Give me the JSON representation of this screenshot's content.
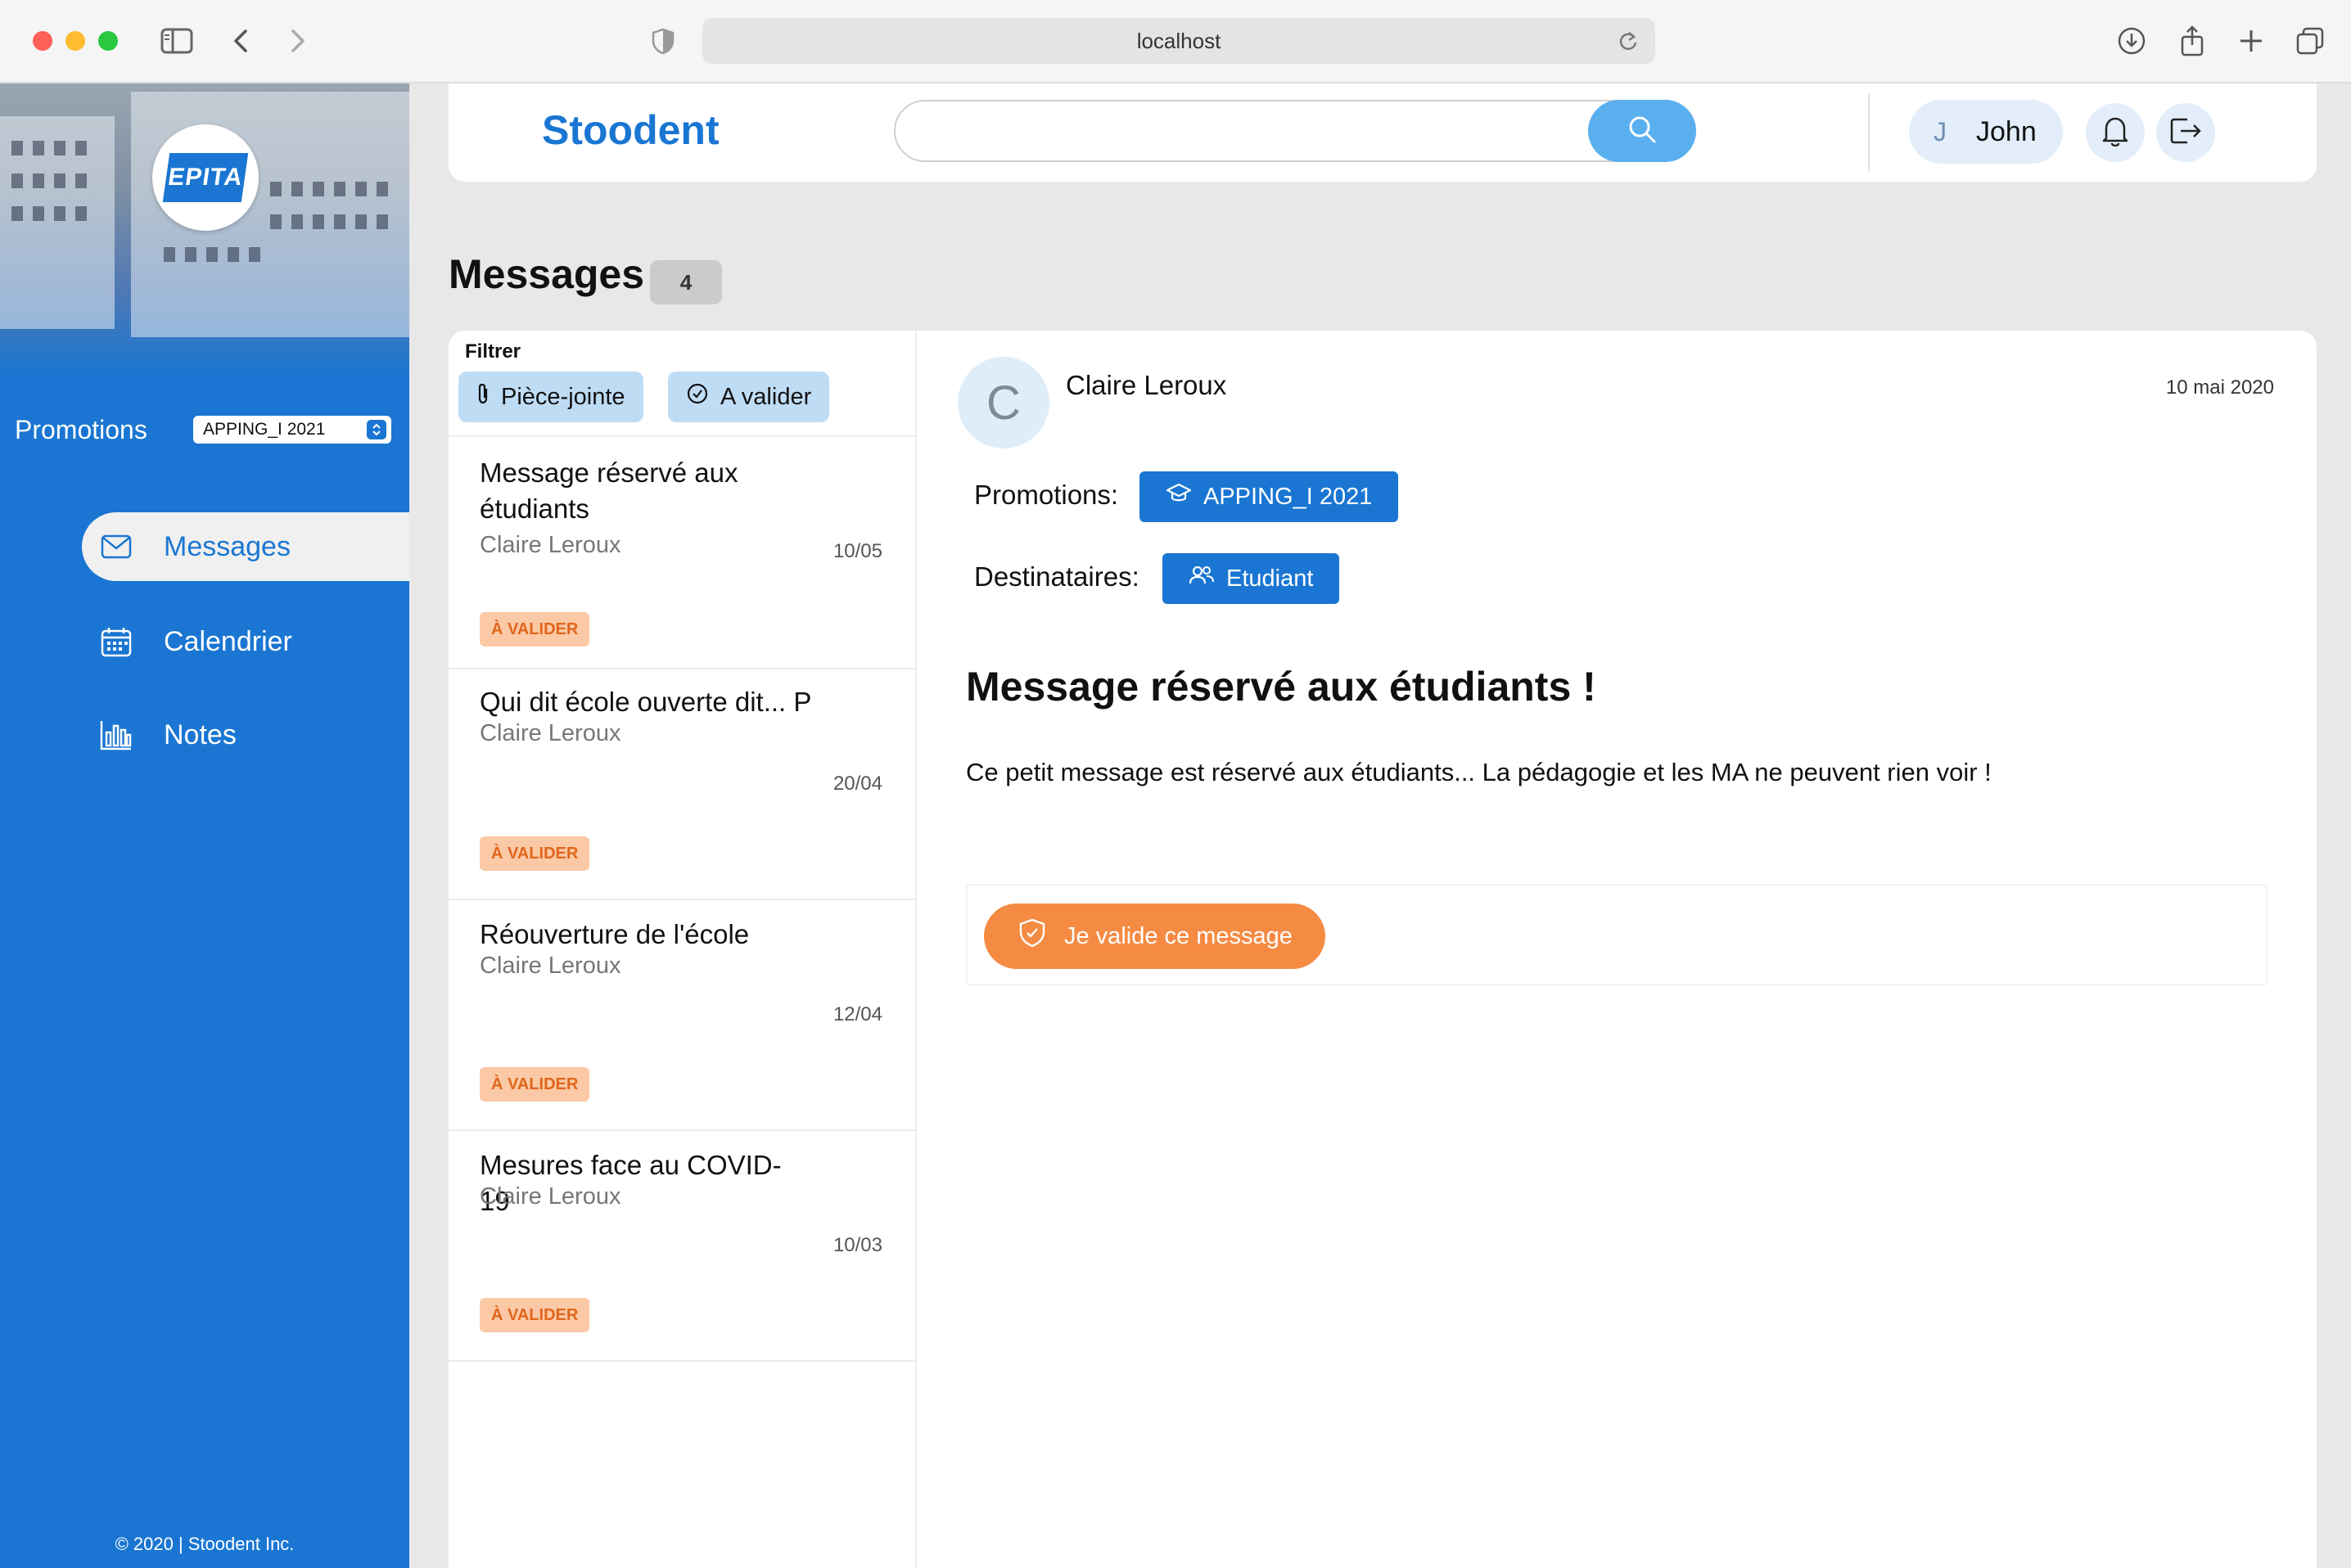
{
  "browser": {
    "url": "localhost"
  },
  "sidebar": {
    "logo_text": "EPITA",
    "promotions_label": "Promotions",
    "promotions_selected": "APPING_I 2021",
    "nav": [
      {
        "label": "Messages",
        "icon": "mail-icon",
        "active": true
      },
      {
        "label": "Calendrier",
        "icon": "calendar-icon",
        "active": false
      },
      {
        "label": "Notes",
        "icon": "bar-chart-icon",
        "active": false
      }
    ],
    "copyright": "© 2020 | Stoodent Inc."
  },
  "header": {
    "brand": "Stoodent",
    "search_value": "",
    "user_initial": "J",
    "user_name": "John"
  },
  "page": {
    "title": "Messages",
    "count": "4"
  },
  "filters": {
    "label": "Filtrer",
    "chips": [
      {
        "label": "Pièce-jointe",
        "icon": "paperclip-icon"
      },
      {
        "label": "A valider",
        "icon": "check-circle-icon"
      }
    ]
  },
  "messages": [
    {
      "title": "Message réservé aux étudiants",
      "author": "Claire Leroux",
      "date": "10/05",
      "badge": "À VALIDER"
    },
    {
      "title": "Qui dit école ouverte dit... P",
      "author": "Claire Leroux",
      "date": "20/04",
      "badge": "À VALIDER"
    },
    {
      "title": "Réouverture de l'école",
      "author": "Claire Leroux",
      "date": "12/04",
      "badge": "À VALIDER"
    },
    {
      "title": "Mesures face au COVID-19",
      "author": "Claire Leroux",
      "date": "10/03",
      "badge": "À VALIDER"
    }
  ],
  "detail": {
    "avatar_initial": "C",
    "sender": "Claire Leroux",
    "date": "10 mai 2020",
    "promotions_label": "Promotions:",
    "promotion_chip": "APPING_I 2021",
    "recipients_label": "Destinataires:",
    "recipient_chip": "Etudiant",
    "title": "Message réservé aux étudiants !",
    "body": "Ce petit message est réservé aux étudiants... La pédagogie et les MA ne peuvent rien voir !",
    "validate_button": "Je valide ce message"
  },
  "colors": {
    "primary": "#1a76d2",
    "search_button": "#5aafef",
    "accent_orange": "#f58b43",
    "badge_bg": "#fbc9a5",
    "badge_text": "#e0661c",
    "filter_chip": "#bfdcf5"
  }
}
